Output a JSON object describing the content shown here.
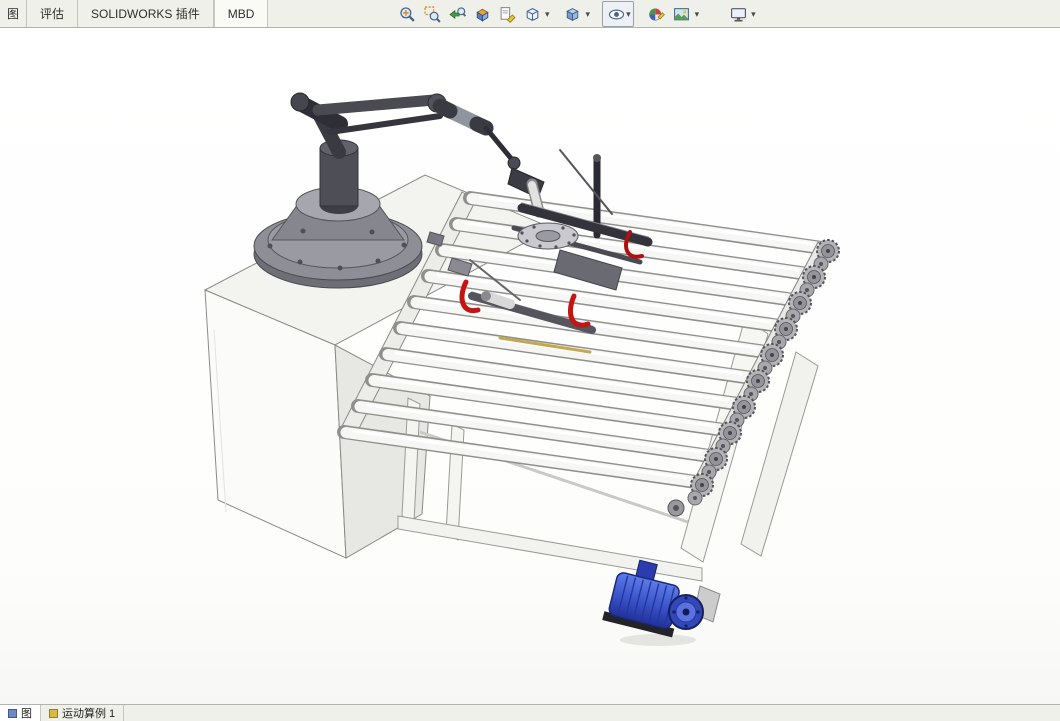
{
  "command_tabs": {
    "items": [
      {
        "label": "图"
      },
      {
        "label": "评估"
      },
      {
        "label": "SOLIDWORKS 插件"
      },
      {
        "label": "MBD"
      }
    ]
  },
  "headsup_toolbar": {
    "icons": [
      {
        "name": "zoom-to-fit-icon",
        "dropdown": false
      },
      {
        "name": "zoom-to-area-icon",
        "dropdown": false
      },
      {
        "name": "previous-view-icon",
        "dropdown": false
      },
      {
        "name": "section-view-icon",
        "dropdown": false
      },
      {
        "name": "dynamic-annotation-views-icon",
        "dropdown": false
      },
      {
        "name": "view-orientation-icon",
        "dropdown": true
      },
      {
        "name": "display-style-icon",
        "dropdown": true
      },
      {
        "name": "hide-show-items-icon",
        "dropdown": true
      },
      {
        "name": "edit-appearance-icon",
        "dropdown": false
      },
      {
        "name": "apply-scene-icon",
        "dropdown": true
      },
      {
        "name": "view-settings-icon",
        "dropdown": true
      }
    ]
  },
  "viewport": {
    "background": "#ffffff",
    "model_parts": [
      "cabinet-base",
      "robot-base",
      "robot-arm",
      "pick-head-gantry",
      "roller-conveyor",
      "sprocket-chain",
      "support-frame",
      "drive-motor",
      "red-straps"
    ]
  },
  "motion_bar": {
    "tabs": [
      {
        "label": "图"
      },
      {
        "label": "运动算例 1"
      }
    ]
  },
  "colors": {
    "header_bg": "#f0f0eb",
    "motor_blue": "#3247b8",
    "strap_red": "#c41414",
    "roller_fill": "#f6f6f4"
  }
}
